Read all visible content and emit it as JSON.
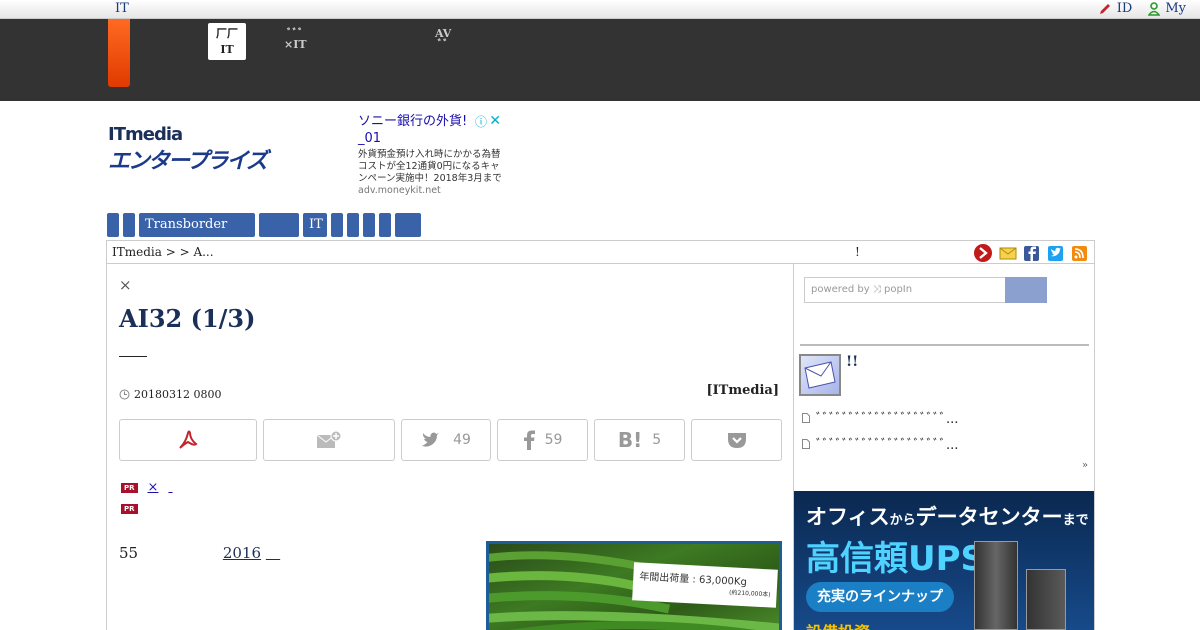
{
  "topbar": {
    "brand": "IT",
    "id_link": "ID",
    "my_link": "My"
  },
  "nav": {
    "tabs": [
      {
        "line1": "厂厂",
        "line2": "IT",
        "active": true
      },
      {
        "line1": "ﾞﾞﾞ",
        "line2": "×IT",
        "active": false
      },
      {
        "line1": "AV",
        "line2": "ﾞﾞ",
        "active": false
      }
    ]
  },
  "logo": {
    "top": "ITmedia",
    "bottom": "エンタープライズ"
  },
  "ad": {
    "title": "ソニー銀行の外貨!",
    "title_suffix": "_01",
    "desc": "外貨預金預け入れ時にかかる為替コストが全12通貨0円になるキャンペーン実施中！2018年3月まで",
    "url": "adv.moneykit.net"
  },
  "menu": {
    "items": [
      "",
      "",
      "Transborder",
      "",
      "IT",
      "",
      "",
      "",
      "",
      ""
    ]
  },
  "breadcrumb": {
    "path": "ITmedia  >    > A...",
    "middle": "!"
  },
  "article": {
    "close": "×",
    "title": "AI32 (1/3)",
    "date": "20180312 0800",
    "source": "[ITmedia]",
    "share": {
      "twitter_count": "49",
      "facebook_count": "59",
      "hatena_count": "5"
    },
    "pr1": "×",
    "pr2": "",
    "body_number": "55",
    "body_link": "2016",
    "photo_tag": "年間出荷量 : 63,000Kg",
    "photo_tag_sub": "(約210,000本)"
  },
  "sidebar": {
    "search_placeholder": "powered by ⤨ popIn",
    "mag_title": "!!",
    "items": [
      "ﾞﾞﾞﾞﾞﾞﾞﾞﾞﾞﾞﾞﾞﾞﾞﾞﾞﾞﾞﾞ...",
      "ﾞﾞﾞﾞﾞﾞﾞﾞﾞﾞﾞﾞﾞﾞﾞﾞﾞﾞﾞﾞ..."
    ],
    "more": "»",
    "banner": {
      "l1a": "オフィス",
      "l1b": "から",
      "l1c": "データセンター",
      "l1d": "まで",
      "l2": "高信頼UPS",
      "pill": "充実のラインナップ",
      "l3": "設備投資..."
    }
  }
}
